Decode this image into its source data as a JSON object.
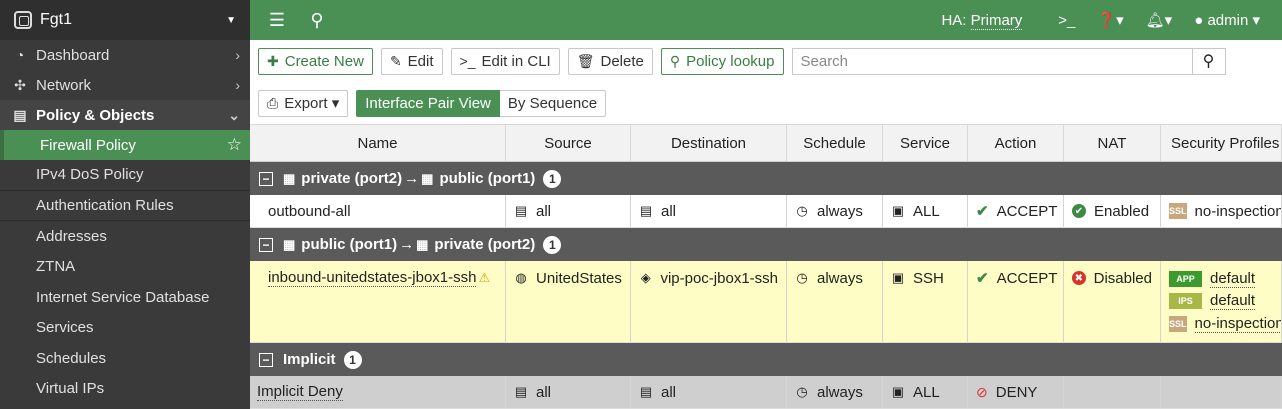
{
  "sidebar": {
    "device": "Fgt1",
    "items": [
      {
        "label": "Dashboard",
        "icon": "dashboard-icon"
      },
      {
        "label": "Network",
        "icon": "network-icon"
      },
      {
        "label": "Policy & Objects",
        "icon": "policy-icon"
      }
    ],
    "active": "Firewall Policy",
    "sub": [
      "IPv4 DoS Policy",
      "Authentication Rules",
      "Addresses",
      "ZTNA",
      "Internet Service Database",
      "Services",
      "Schedules",
      "Virtual IPs"
    ]
  },
  "topbar": {
    "ha_label": "HA:",
    "ha_value": "Primary",
    "user": "admin"
  },
  "toolbar": {
    "create_new": "Create New",
    "edit": "Edit",
    "edit_cli": "Edit in CLI",
    "delete": "Delete",
    "policy_lookup": "Policy lookup",
    "search_placeholder": "Search",
    "export": "Export",
    "view_pair": "Interface Pair View",
    "view_seq": "By Sequence"
  },
  "table": {
    "headers": [
      "Name",
      "Source",
      "Destination",
      "Schedule",
      "Service",
      "Action",
      "NAT",
      "Security Profiles"
    ],
    "groups": [
      {
        "from": "private (port2)",
        "to": "public (port1)",
        "count": "1",
        "row": {
          "name": "outbound-all",
          "source": "all",
          "destination": "all",
          "schedule": "always",
          "service": "ALL",
          "action": "ACCEPT",
          "nat": "Enabled",
          "profiles": [
            {
              "badge": "SSL",
              "value": "no-inspection"
            }
          ]
        }
      },
      {
        "from": "public (port1)",
        "to": "private (port2)",
        "count": "1",
        "row": {
          "name": "inbound-unitedstates-jbox1-ssh",
          "source": "UnitedStates",
          "destination": "vip-poc-jbox1-ssh",
          "schedule": "always",
          "service": "SSH",
          "action": "ACCEPT",
          "nat": "Disabled",
          "profiles": [
            {
              "badge": "APP",
              "value": "default"
            },
            {
              "badge": "IPS",
              "value": "default"
            },
            {
              "badge": "SSL",
              "value": "no-inspection"
            }
          ]
        }
      }
    ],
    "implicit": {
      "label": "Implicit",
      "count": "1",
      "row": {
        "name": "Implicit Deny",
        "source": "all",
        "destination": "all",
        "schedule": "always",
        "service": "ALL",
        "action": "DENY"
      }
    }
  }
}
